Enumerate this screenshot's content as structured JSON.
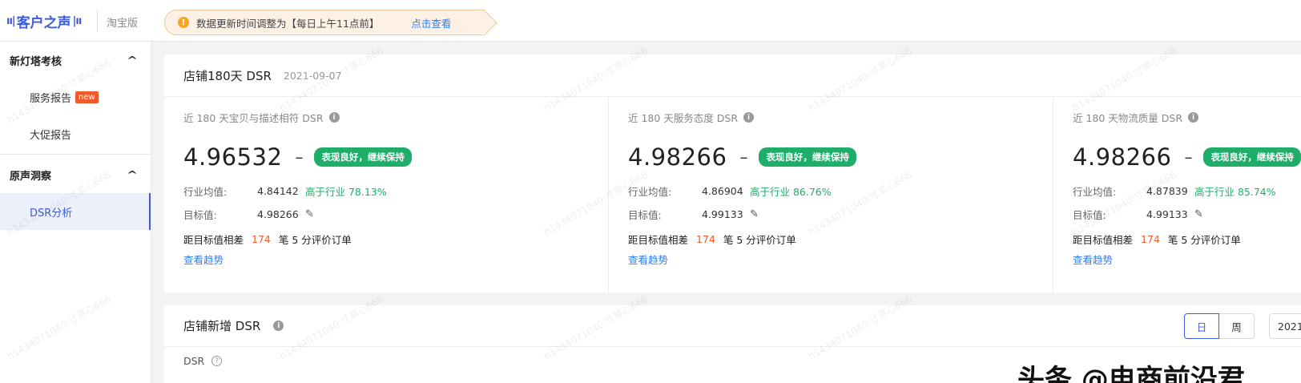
{
  "header": {
    "logo_text": "客户之声",
    "edition": "淘宝版",
    "notice_text": "数据更新时间调整为【每日上午11点前】",
    "notice_link": "点击查看"
  },
  "sidebar": {
    "groups": [
      {
        "label": "新灯塔考核",
        "items": [
          {
            "label": "服务报告",
            "badge": "new"
          },
          {
            "label": "大促报告"
          }
        ]
      },
      {
        "label": "原声洞察",
        "items": [
          {
            "label": "DSR分析",
            "active": true
          }
        ]
      }
    ]
  },
  "card1": {
    "title": "店铺180天 DSR",
    "date": "2021-09-07",
    "metrics": [
      {
        "label": "近 180 天宝贝与描述相符 DSR",
        "value": "4.96532",
        "dash": "–",
        "tag": "表现良好，继续保持",
        "avg_label": "行业均值:",
        "avg_value": "4.84142",
        "compare": "高于行业 78.13%",
        "target_label": "目标值:",
        "target_value": "4.98266",
        "gap_prefix": "距目标值相差",
        "gap_num": "174",
        "gap_suffix": "笔 5 分评价订单",
        "trend_link": "查看趋势"
      },
      {
        "label": "近 180 天服务态度 DSR",
        "value": "4.98266",
        "dash": "–",
        "tag": "表现良好，继续保持",
        "avg_label": "行业均值:",
        "avg_value": "4.86904",
        "compare": "高于行业 86.76%",
        "target_label": "目标值:",
        "target_value": "4.99133",
        "gap_prefix": "距目标值相差",
        "gap_num": "174",
        "gap_suffix": "笔 5 分评价订单",
        "trend_link": "查看趋势"
      },
      {
        "label": "近 180 天物流质量 DSR",
        "value": "4.98266",
        "dash": "–",
        "tag": "表现良好，继续保持",
        "avg_label": "行业均值:",
        "avg_value": "4.87839",
        "compare": "高于行业 85.74%",
        "target_label": "目标值:",
        "target_value": "4.99133",
        "gap_prefix": "距目标值相差",
        "gap_num": "174",
        "gap_suffix": "笔 5 分评价订单",
        "trend_link": "查看趋势"
      }
    ]
  },
  "card2": {
    "title": "店铺新增 DSR",
    "toggle_day": "日",
    "toggle_week": "周",
    "date_value": "2021",
    "sub_label": "DSR"
  },
  "watermark_text": "h1434071040:寸草心666",
  "overlay_text": "头条 @电商前沿君",
  "colors": {
    "brand": "#3d5bd9",
    "good": "#1fae6a",
    "alert": "#f05a28",
    "link": "#2d7ff9"
  }
}
